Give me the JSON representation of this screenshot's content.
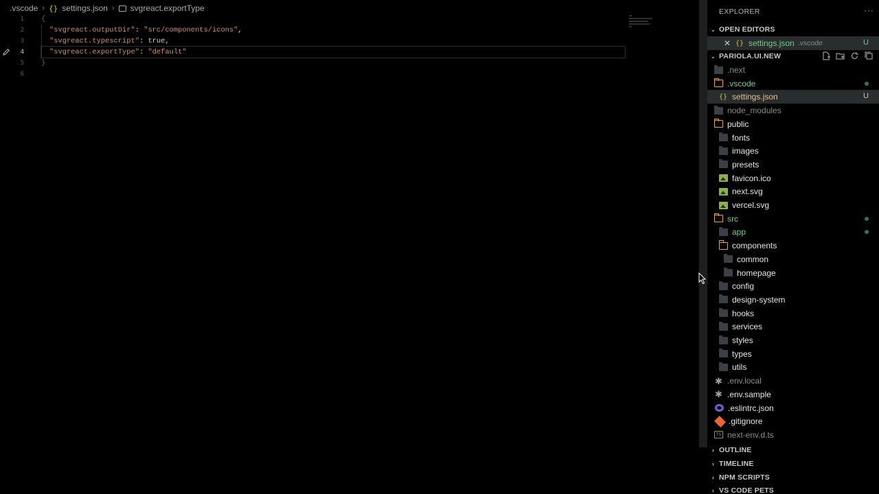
{
  "breadcrumb": {
    "folder": ".vscode",
    "file": "settings.json",
    "file_icon": "{}",
    "symbol": "svgreact.exportType"
  },
  "editor": {
    "line_numbers": [
      "1",
      "2",
      "3",
      "4",
      "5",
      "6"
    ],
    "active_line": 4,
    "lines": {
      "l1_open": "{",
      "l2_key": "\"svgreact.outputDir\"",
      "l2_val": "\"src/components/icons\"",
      "l3_key": "\"svgreact.typescript\"",
      "l3_val": "true",
      "l4_key": "\"svgreact.exportType\"",
      "l4_val": "\"default\"",
      "l5_close": "}"
    },
    "punct": {
      "colon": ": ",
      "comma": ","
    }
  },
  "explorer": {
    "title": "EXPLORER",
    "more": "···",
    "open_editors": {
      "label": "OPEN EDITORS",
      "item_name": "settings.json",
      "item_desc": ".vscode",
      "item_badge": "U",
      "close_glyph": "✕"
    },
    "project": {
      "label": "PARIOLA.UI.NEW",
      "tree": [
        {
          "label": ".next",
          "kind": "folder",
          "color": "dim"
        },
        {
          "label": ".vscode",
          "kind": "folder-open",
          "color": "green",
          "badge": "dot"
        },
        {
          "label": "settings.json",
          "kind": "json",
          "color": "orange",
          "badge": "U"
        },
        {
          "label": "node_modules",
          "kind": "folder",
          "color": "dim"
        },
        {
          "label": "public",
          "kind": "folder-open",
          "color": "white"
        },
        {
          "label": "fonts",
          "kind": "folder",
          "color": "white"
        },
        {
          "label": "images",
          "kind": "folder",
          "color": "white"
        },
        {
          "label": "presets",
          "kind": "folder",
          "color": "white"
        },
        {
          "label": "favicon.ico",
          "kind": "image",
          "color": "white"
        },
        {
          "label": "next.svg",
          "kind": "image",
          "color": "white"
        },
        {
          "label": "vercel.svg",
          "kind": "image",
          "color": "white"
        },
        {
          "label": "src",
          "kind": "folder-open",
          "color": "green",
          "badge": "dot"
        },
        {
          "label": "app",
          "kind": "folder",
          "color": "green",
          "badge": "dot"
        },
        {
          "label": "components",
          "kind": "folder-open",
          "color": "white"
        },
        {
          "label": "common",
          "kind": "folder",
          "color": "white"
        },
        {
          "label": "homepage",
          "kind": "folder",
          "color": "white"
        },
        {
          "label": "config",
          "kind": "folder",
          "color": "white"
        },
        {
          "label": "design-system",
          "kind": "folder",
          "color": "white"
        },
        {
          "label": "hooks",
          "kind": "folder",
          "color": "white"
        },
        {
          "label": "services",
          "kind": "folder",
          "color": "white"
        },
        {
          "label": "styles",
          "kind": "folder",
          "color": "white"
        },
        {
          "label": "types",
          "kind": "folder",
          "color": "white"
        },
        {
          "label": "utils",
          "kind": "folder",
          "color": "white"
        },
        {
          "label": ".env.local",
          "kind": "star",
          "color": "dim"
        },
        {
          "label": ".env.sample",
          "kind": "star",
          "color": "white"
        },
        {
          "label": ".eslintrc.json",
          "kind": "eslint",
          "color": "white"
        },
        {
          "label": ".gitignore",
          "kind": "git",
          "color": "white"
        },
        {
          "label": "next-env.d.ts",
          "kind": "ts",
          "color": "dim"
        }
      ]
    },
    "sections": [
      "OUTLINE",
      "TIMELINE",
      "NPM SCRIPTS",
      "VS CODE PETS"
    ]
  },
  "icons": {
    "chevron_down": "chevron-down-icon",
    "chevron_right": "chevron-right-icon",
    "new_file": "new-file-icon",
    "new_folder": "new-folder-icon",
    "refresh": "refresh-icon",
    "collapse": "collapse-all-icon"
  },
  "colors": {
    "background": "#000000",
    "git_untracked": "#73c991",
    "git_modified": "#e2c08d",
    "folder_open": "#e7a838",
    "selection": "#2a2d2e"
  }
}
